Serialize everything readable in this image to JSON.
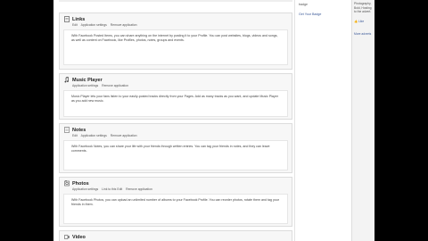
{
  "apps": [
    {
      "name": "Links",
      "icon": "link-icon",
      "actions": [
        "Edit",
        "Application settings",
        "Remove application"
      ],
      "description": "With Facebook Posted Items, you can share anything on the internet by posting it to your Profile. You can post websites, blogs, videos and songs, as well as content on Facebook, like Profiles, photos, notes, groups and events."
    },
    {
      "name": "Music Player",
      "icon": "music-note-icon",
      "actions": [
        "Application settings",
        "Remove application"
      ],
      "description": "Music Player lets your fans listen to your easily-posted tracks directly from your Pages. Add as many tracks as you want, and update Music Player as you add new music."
    },
    {
      "name": "Notes",
      "icon": "notes-icon",
      "actions": [
        "Edit",
        "Application settings",
        "Remove application"
      ],
      "description": "With Facebook Notes, you can share your life with your friends through written entries. You can tag your friends in notes, and they can leave comments."
    },
    {
      "name": "Photos",
      "icon": "photos-icon",
      "actions": [
        "Application settings",
        "Link to this Edit",
        "Remove application"
      ],
      "description": "With Facebook Photos, you can upload an unlimited number of albums to your Facebook Profile. You can reorder photos, rotate them and tag your friends in them."
    },
    {
      "name": "Video",
      "icon": "video-icon",
      "actions": [],
      "description": ""
    }
  ],
  "right_column": {
    "text": "badge",
    "link": "Get Your Badge"
  },
  "side_strip": {
    "text": "Photography, Bold, Hosting to the advert.",
    "like_label": "Like",
    "more_label": "More adverts"
  }
}
